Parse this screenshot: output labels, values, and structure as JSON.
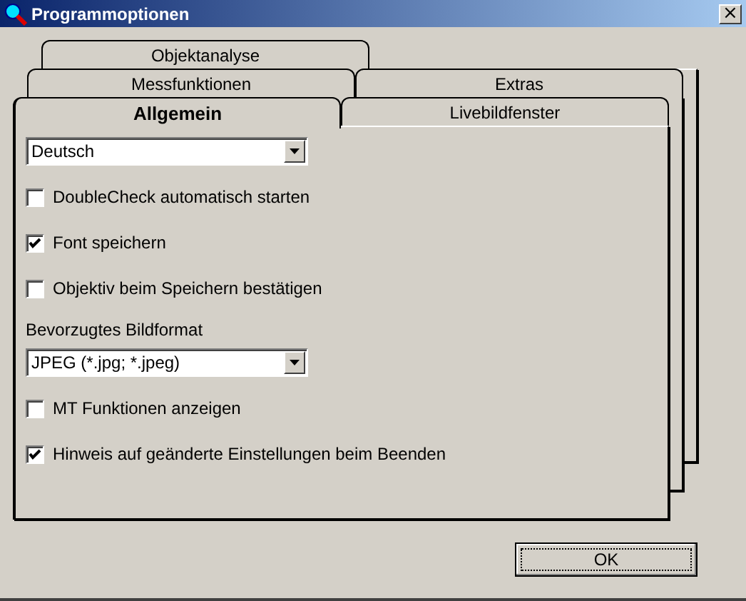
{
  "window": {
    "title": "Programmoptionen",
    "close": "×"
  },
  "tab_rows": [
    [
      {
        "label": "Objektanalyse",
        "selected": false
      }
    ],
    [
      {
        "label": "Messfunktionen",
        "selected": false
      },
      {
        "label": "Extras",
        "selected": false
      }
    ],
    [
      {
        "label": "Allgemein",
        "selected": true
      },
      {
        "label": "Livebildfenster",
        "selected": false
      }
    ]
  ],
  "items": [
    {
      "kind": "dropdown",
      "value": "Deutsch"
    },
    {
      "kind": "checkbox",
      "label": "DoubleCheck automatisch starten",
      "checked": false
    },
    {
      "kind": "checkbox",
      "label": "Font speichern",
      "checked": true
    },
    {
      "kind": "checkbox",
      "label": "Objektiv beim Speichern bestätigen",
      "checked": false
    },
    {
      "kind": "label",
      "label": "Bevorzugtes Bildformat"
    },
    {
      "kind": "dropdown",
      "value": "JPEG (*.jpg; *.jpeg)"
    },
    {
      "kind": "checkbox",
      "label": "MT Funktionen anzeigen",
      "checked": false
    },
    {
      "kind": "checkbox",
      "label": "Hinweis auf geänderte Einstellungen beim Beenden",
      "checked": true
    }
  ],
  "buttons": [
    {
      "label": "OK"
    }
  ]
}
